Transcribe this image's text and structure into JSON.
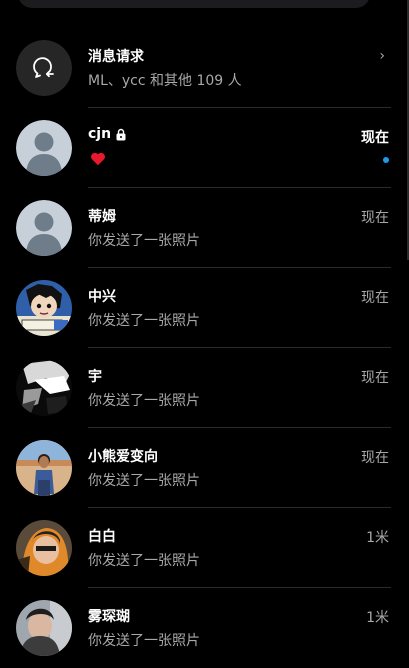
{
  "message_requests": {
    "title": "消息请求",
    "subtitle": "ML、ycc 和其他 109 人",
    "chevron": "›",
    "icon": "message-request-icon"
  },
  "conversations": [
    {
      "name": "cjn",
      "locked": true,
      "preview_icon": "heart-icon",
      "time": "现在",
      "unread": true,
      "accent": "#1d9bf0"
    },
    {
      "name": "蒂姆",
      "preview": "你发送了一张照片",
      "time": "现在"
    },
    {
      "name": "中兴",
      "preview": "你发送了一张照片",
      "time": "现在"
    },
    {
      "name": "宇",
      "preview": "你发送了一张照片",
      "time": "现在"
    },
    {
      "name": "小熊爱变向",
      "preview": "你发送了一张照片",
      "time": "现在"
    },
    {
      "name": "白白",
      "preview": "你发送了一张照片",
      "time": "1米"
    },
    {
      "name": "雾琛瑚",
      "preview": "你发送了一张照片",
      "time": "1米"
    }
  ],
  "colors": {
    "background": "#000000",
    "primary_text": "#ffffff",
    "secondary_text": "#a8a8a8",
    "unread_dot": "#1d9bf0",
    "heart": "#e8192c"
  }
}
